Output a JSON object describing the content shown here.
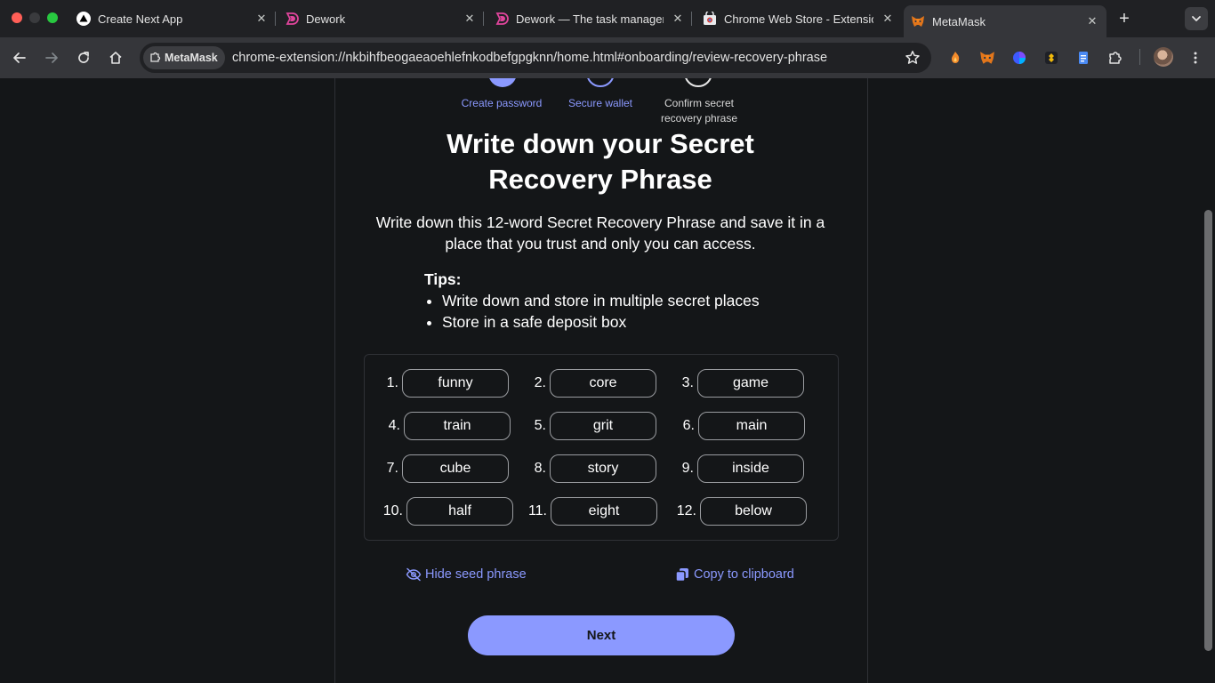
{
  "browser": {
    "tabs": [
      {
        "title": "Create Next App",
        "icon": "triangle-icon"
      },
      {
        "title": "Dework",
        "icon": "dework-icon"
      },
      {
        "title": "Dework — The task manager",
        "icon": "dework-icon"
      },
      {
        "title": "Chrome Web Store - Extensio",
        "icon": "webstore-icon"
      },
      {
        "title": "MetaMask",
        "icon": "metamask-fox-icon",
        "active": true
      }
    ],
    "site_chip": "MetaMask",
    "url": "chrome-extension://nkbihfbeogaeaoehlefnkodbefgpgknn/home.html#onboarding/review-recovery-phrase"
  },
  "stepper": {
    "steps": [
      {
        "label": "Create password",
        "state": "complete"
      },
      {
        "label": "Secure wallet",
        "state": "current"
      },
      {
        "label": "Confirm secret recovery phrase",
        "state": "upcoming"
      }
    ]
  },
  "content": {
    "title": "Write down your Secret Recovery Phrase",
    "description": "Write down this 12-word Secret Recovery Phrase and save it in a place that you trust and only you can access.",
    "tips_heading": "Tips:",
    "tips": [
      "Write down and store in multiple secret places",
      "Store in a safe deposit box"
    ],
    "words": [
      {
        "num": "1.",
        "word": "funny"
      },
      {
        "num": "2.",
        "word": "core"
      },
      {
        "num": "3.",
        "word": "game"
      },
      {
        "num": "4.",
        "word": "train"
      },
      {
        "num": "5.",
        "word": "grit"
      },
      {
        "num": "6.",
        "word": "main"
      },
      {
        "num": "7.",
        "word": "cube"
      },
      {
        "num": "8.",
        "word": "story"
      },
      {
        "num": "9.",
        "word": "inside"
      },
      {
        "num": "10.",
        "word": "half"
      },
      {
        "num": "11.",
        "word": "eight"
      },
      {
        "num": "12.",
        "word": "below"
      }
    ],
    "hide_label": "Hide seed phrase",
    "copy_label": "Copy to clipboard",
    "next_label": "Next"
  },
  "colors": {
    "accent": "#8b99ff",
    "background": "#141618"
  }
}
